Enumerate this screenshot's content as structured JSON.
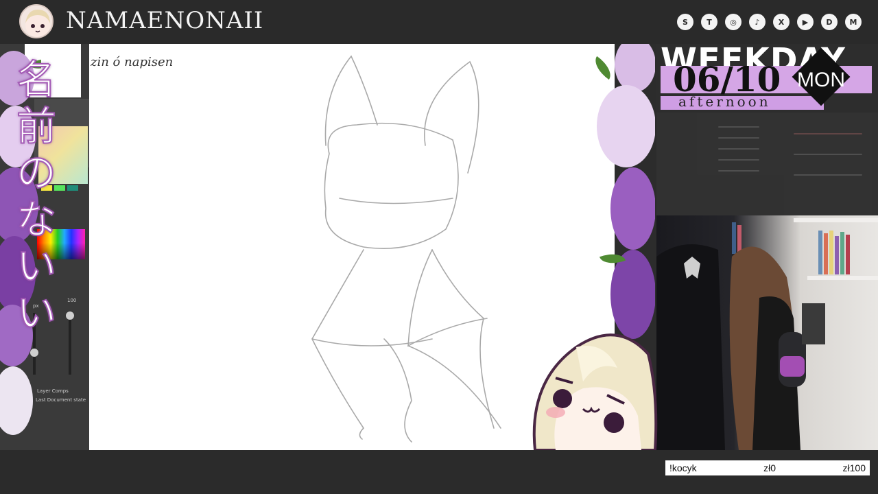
{
  "header": {
    "brand": "NAMAENONAII",
    "socials": [
      {
        "icon": "streamelements-icon",
        "glyph": "S"
      },
      {
        "icon": "twitch-icon",
        "glyph": "T"
      },
      {
        "icon": "instagram-icon",
        "glyph": "◎"
      },
      {
        "icon": "tiktok-icon",
        "glyph": "♪"
      },
      {
        "icon": "x-icon",
        "glyph": "X"
      },
      {
        "icon": "youtube-icon",
        "glyph": "▶"
      },
      {
        "icon": "discord-icon",
        "glyph": "D"
      },
      {
        "icon": "gmail-icon",
        "glyph": "M"
      }
    ]
  },
  "sidebar_vertical_text": [
    "名",
    "前",
    "の",
    "な",
    "い",
    "い"
  ],
  "canvas": {
    "handwriting": "zin ó napisen"
  },
  "left_panel": {
    "opacity_value": "100",
    "unit": "px",
    "layer_comps_label": "Layer Comps",
    "document_state": "Last Document state"
  },
  "schedule": {
    "title": "WEEKDAY",
    "date": "06/10",
    "day": "MON",
    "period": "afternoon"
  },
  "ticker": {
    "command": "!kocyk",
    "current": "zł0",
    "goal": "zł100"
  },
  "colors": {
    "accent_purple": "#d5a6e6",
    "lilac": "#b784d0",
    "background": "#2b2b2b"
  }
}
